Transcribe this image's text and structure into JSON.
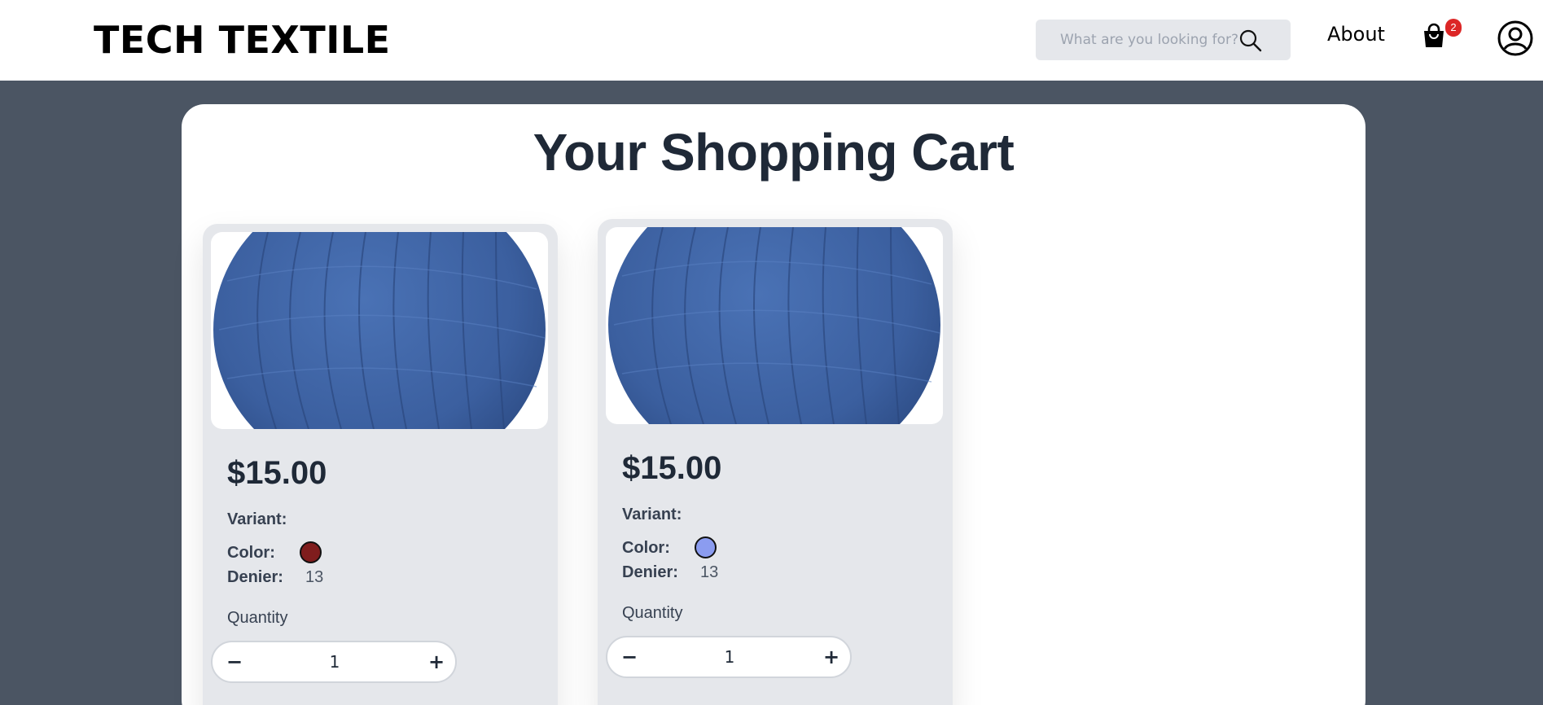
{
  "header": {
    "brand": "TECH TEXTILE",
    "search_placeholder": "What are you looking for?",
    "about_label": "About",
    "cart_count": "2"
  },
  "main": {
    "title": "Your Shopping Cart",
    "items": [
      {
        "price": "$15.00",
        "variant_label": "Variant:",
        "color_label": "Color:",
        "color_value": "#7f1d1d",
        "denier_label": "Denier:",
        "denier_value": "13",
        "quantity_label": "Quantity",
        "quantity": "1",
        "minus_label": "−",
        "plus_label": "+",
        "image_icon": "yarn-ball-image"
      },
      {
        "price": "$15.00",
        "variant_label": "Variant:",
        "color_label": "Color:",
        "color_value": "#8b9cf0",
        "denier_label": "Denier:",
        "denier_value": "13",
        "quantity_label": "Quantity",
        "quantity": "1",
        "minus_label": "−",
        "plus_label": "+",
        "image_icon": "yarn-ball-image"
      }
    ]
  },
  "colors": {
    "backdrop": "#4b5563",
    "card": "#e5e7eb",
    "badge": "#dc2626",
    "yarn": "#3f65a8"
  }
}
